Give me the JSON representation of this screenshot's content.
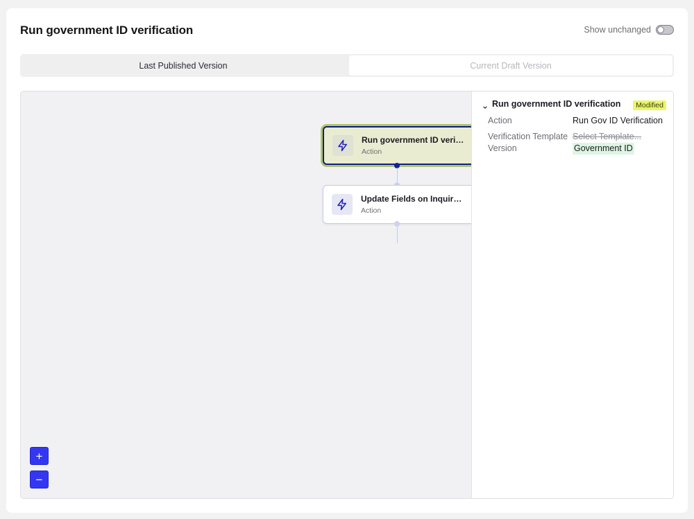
{
  "header": {
    "title": "Run government ID verification",
    "show_unchanged_label": "Show unchanged",
    "show_unchanged_enabled": false
  },
  "tabs": [
    {
      "label": "Last Published Version",
      "active": true
    },
    {
      "label": "Current Draft Version",
      "active": false
    }
  ],
  "canvas": {
    "nodes": [
      {
        "title": "Run government ID verific...",
        "subtitle": "Action",
        "icon": "lightning-bolt-icon",
        "selected": true
      },
      {
        "title": "Update Fields on Inquiry F...",
        "subtitle": "Action",
        "icon": "lightning-bolt-icon",
        "selected": false
      }
    ],
    "zoom_in_label": "+",
    "zoom_out_label": "−"
  },
  "details": {
    "title": "Run government ID verification",
    "badge": "Modified",
    "rows": [
      {
        "label": "Action",
        "value": "Run Gov ID Verification"
      },
      {
        "label": "Verification Template Version",
        "old_value": "Select Template...",
        "new_value": "Government ID"
      }
    ]
  },
  "colors": {
    "accent": "#3437f2",
    "selected_border": "#0c1e8c",
    "selected_glow": "#b3c565",
    "modified_badge": "#e8f766",
    "added_value_bg": "#dff5e4"
  }
}
